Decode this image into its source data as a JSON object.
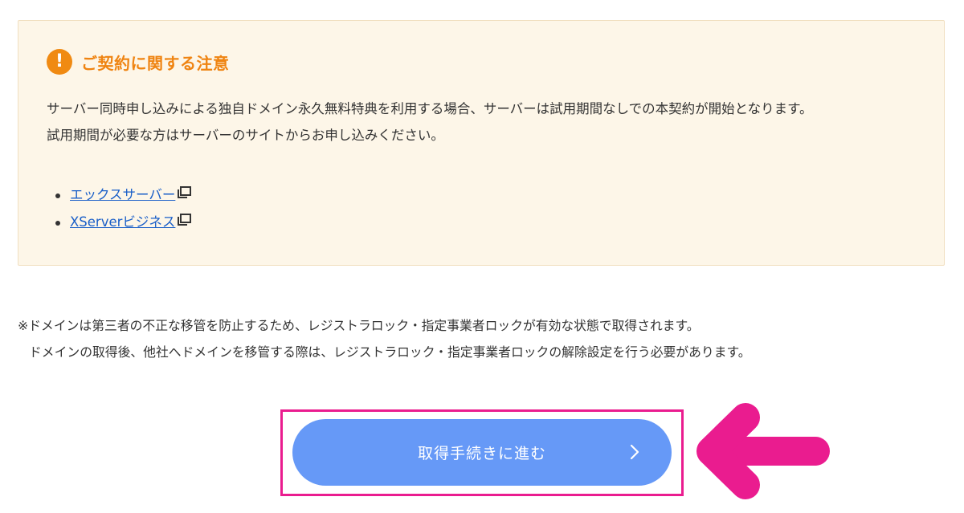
{
  "notice": {
    "icon": "exclamation-icon",
    "title": "ご契約に関する注意",
    "paragraph1": "サーバー同時申し込みによる独自ドメイン永久無料特典を利用する場合、サーバーは試用期間なしでの本契約が開始となります。",
    "paragraph2": "試用期間が必要な方はサーバーのサイトからお申し込みください。",
    "links": [
      {
        "label": "エックスサーバー",
        "icon": "external-link-icon"
      },
      {
        "label": "XServerビジネス",
        "icon": "external-link-icon"
      }
    ]
  },
  "note": {
    "line1": "※ドメインは第三者の不正な移管を防止するため、レジストラロック・指定事業者ロックが有効な状態で取得されます。",
    "line2": "ドメインの取得後、他社へドメインを移管する際は、レジストラロック・指定事業者ロックの解除設定を行う必要があります。"
  },
  "proceed_button": {
    "label": "取得手続きに進む",
    "icon": "chevron-right-icon"
  },
  "colors": {
    "accent_orange": "#ef8412",
    "button_blue": "#6699f7",
    "highlight_pink": "#ea1c8f",
    "link_blue": "#1a5fc8"
  }
}
